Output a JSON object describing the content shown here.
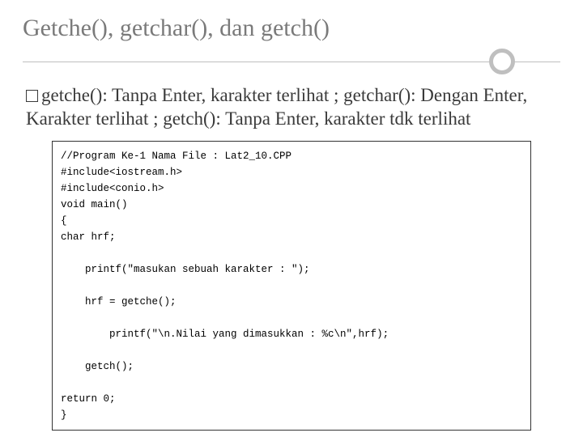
{
  "slide": {
    "title": "Getche(), getchar(), dan getch()",
    "body": "getche(): Tanpa Enter, karakter terlihat ; getchar(): Dengan Enter, Karakter terlihat ; getch(): Tanpa Enter, karakter tdk terlihat",
    "code": "//Program Ke-1 Nama File : Lat2_10.CPP\n#include<iostream.h>\n#include<conio.h>\nvoid main()\n{\nchar hrf;\n\n    printf(\"masukan sebuah karakter : \");\n\n    hrf = getche();\n\n        printf(\"\\n.Nilai yang dimasukkan : %c\\n\",hrf);\n\n    getch();\n\nreturn 0;\n}"
  }
}
